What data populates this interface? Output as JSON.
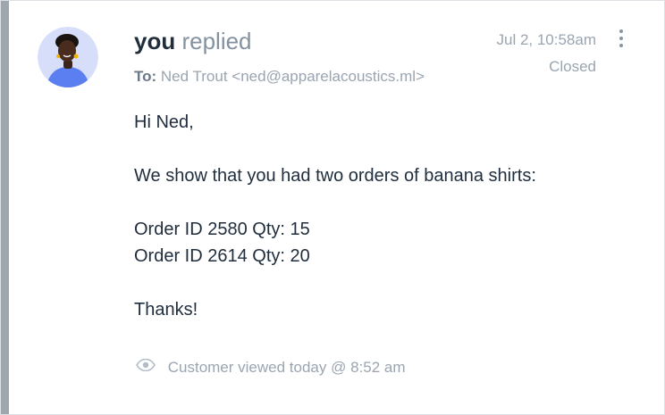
{
  "message": {
    "author": "you",
    "action": "replied",
    "to_label": "To:",
    "to_value": "Ned Trout <ned@apparelacoustics.ml>",
    "timestamp": "Jul 2, 10:58am",
    "status": "Closed",
    "body": {
      "greeting": "Hi Ned,",
      "line1": "We show that you had two orders of banana shirts:",
      "order1": "Order ID 2580 Qty: 15",
      "order2": "Order ID 2614 Qty: 20",
      "closing": "Thanks!"
    },
    "viewed": "Customer viewed today @ 8:52 am"
  },
  "icons": {
    "more": "more-vertical-icon",
    "viewed": "eye-icon",
    "avatar": "user-avatar"
  },
  "colors": {
    "accent_bar": "#9ea6ae",
    "author_text": "#1f2d3d",
    "muted_text": "#9aa5b1",
    "avatar_bg": "#d6defa",
    "avatar_shirt": "#5b7ff0"
  }
}
